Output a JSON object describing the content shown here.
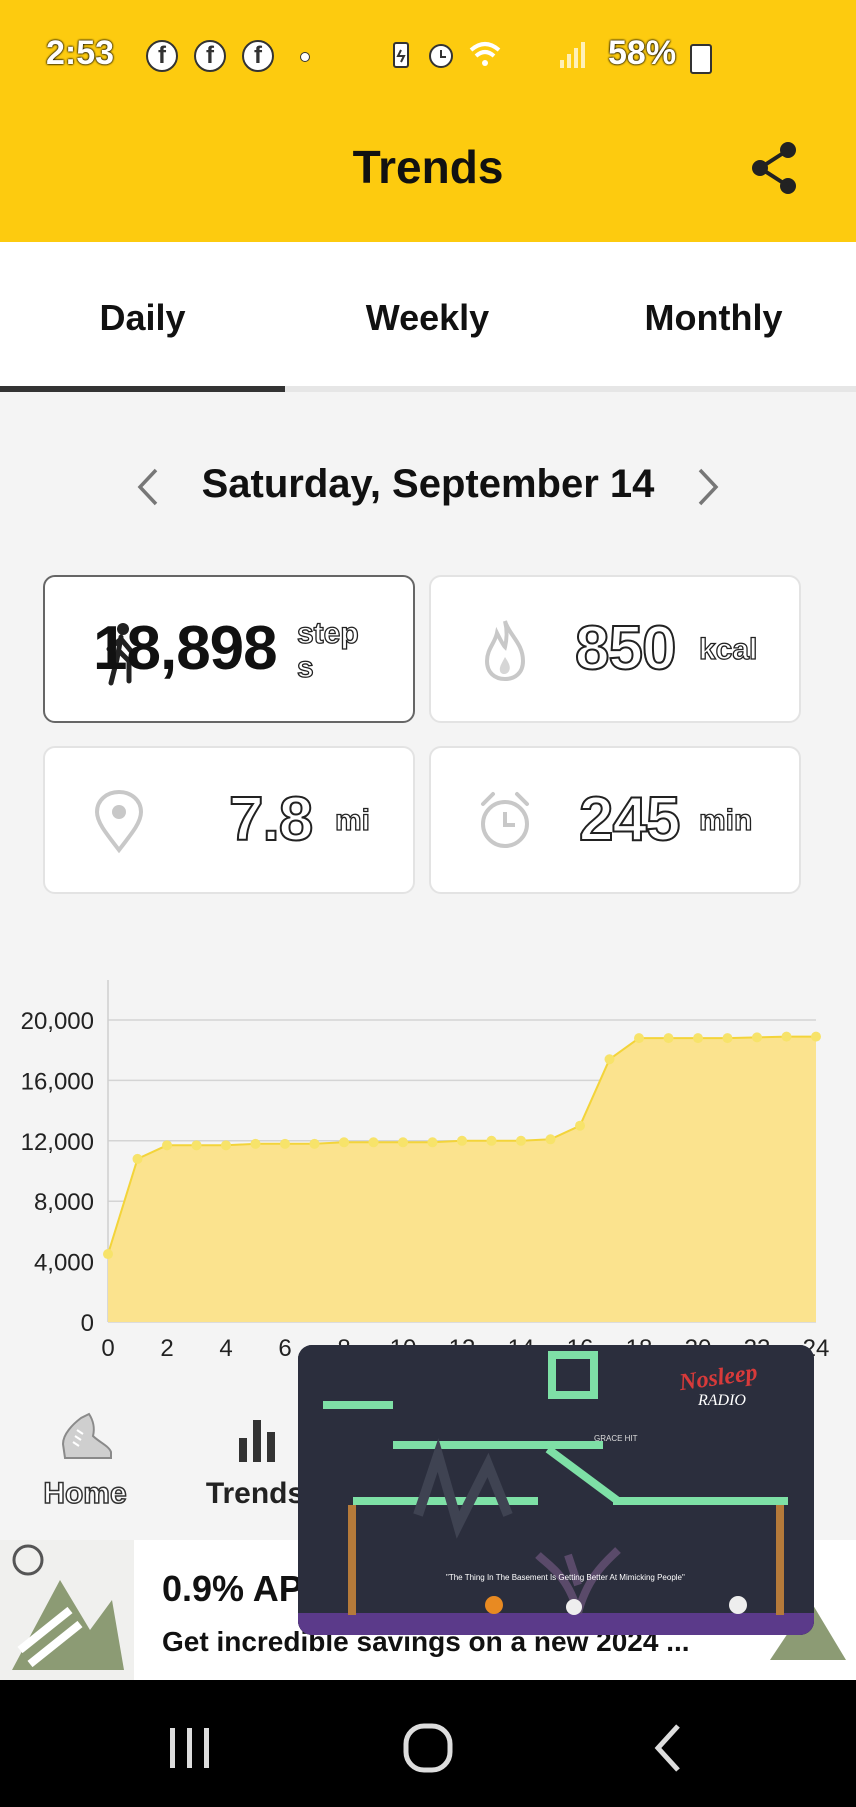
{
  "status_bar": {
    "time": "2:53",
    "notification_icons": [
      "facebook-icon",
      "facebook-icon",
      "facebook-icon"
    ],
    "system_icons": [
      "battery-saver-icon",
      "alarm-icon",
      "wifi-icon",
      "lte-icon",
      "signal-icon"
    ],
    "battery_percent": "58%"
  },
  "header": {
    "title": "Trends",
    "share_icon": "share-icon",
    "background_color": "#fdcb0f"
  },
  "tabs": [
    {
      "label": "Daily",
      "selected": true
    },
    {
      "label": "Weekly",
      "selected": false
    },
    {
      "label": "Monthly",
      "selected": false
    }
  ],
  "date_nav": {
    "date": "Saturday, September 14",
    "prev_icon": "chevron-left-icon",
    "next_icon": "chevron-right-icon"
  },
  "metrics": [
    {
      "icon": "walking-person-icon",
      "value": "18,898",
      "unit": "step s",
      "selected": true
    },
    {
      "icon": "flame-icon",
      "value": "850",
      "unit": "kcal",
      "selected": false
    },
    {
      "icon": "location-pin-icon",
      "value": "7.8",
      "unit": "mi",
      "selected": false
    },
    {
      "icon": "alarm-clock-icon",
      "value": "245",
      "unit": "min",
      "selected": false
    }
  ],
  "chart_data": {
    "type": "area",
    "x": [
      0,
      1,
      2,
      3,
      4,
      5,
      6,
      7,
      8,
      9,
      10,
      11,
      12,
      13,
      14,
      15,
      16,
      17,
      18,
      19,
      20,
      21,
      22,
      23,
      24
    ],
    "values": [
      4500,
      10800,
      11700,
      11700,
      11700,
      11800,
      11800,
      11800,
      11900,
      11900,
      11900,
      11900,
      12000,
      12000,
      12000,
      12100,
      13000,
      17400,
      18800,
      18800,
      18800,
      18800,
      18850,
      18900,
      18900
    ],
    "xticks": [
      "0",
      "2",
      "4",
      "6",
      "8",
      "10",
      "12",
      "14",
      "16",
      "18",
      "20",
      "22",
      "24"
    ],
    "yticks": [
      "0",
      "4,000",
      "8,000",
      "12,000",
      "16,000",
      "20,000"
    ],
    "ylim": [
      0,
      20000
    ],
    "xlim": [
      0,
      24
    ],
    "grid": true,
    "color": "#fbe38e",
    "line_color": "#f3d43a"
  },
  "bottom_nav": [
    {
      "label": "Home",
      "icon": "shoe-icon"
    },
    {
      "label": "Trends",
      "icon": "bar-chart-icon"
    }
  ],
  "ad": {
    "title": "0.9% AP",
    "subtitle": "Get incredible savings on a new 2024 ..."
  },
  "video": {
    "channel": "The Nosleep Radio",
    "caption": "\"The Thing In The Basement Is Getting Better At Mimicking People\"",
    "hud_text": "GRACE HIT"
  },
  "system_nav": {
    "recents": "recents-icon",
    "home": "home-circle-icon",
    "back": "back-icon"
  }
}
